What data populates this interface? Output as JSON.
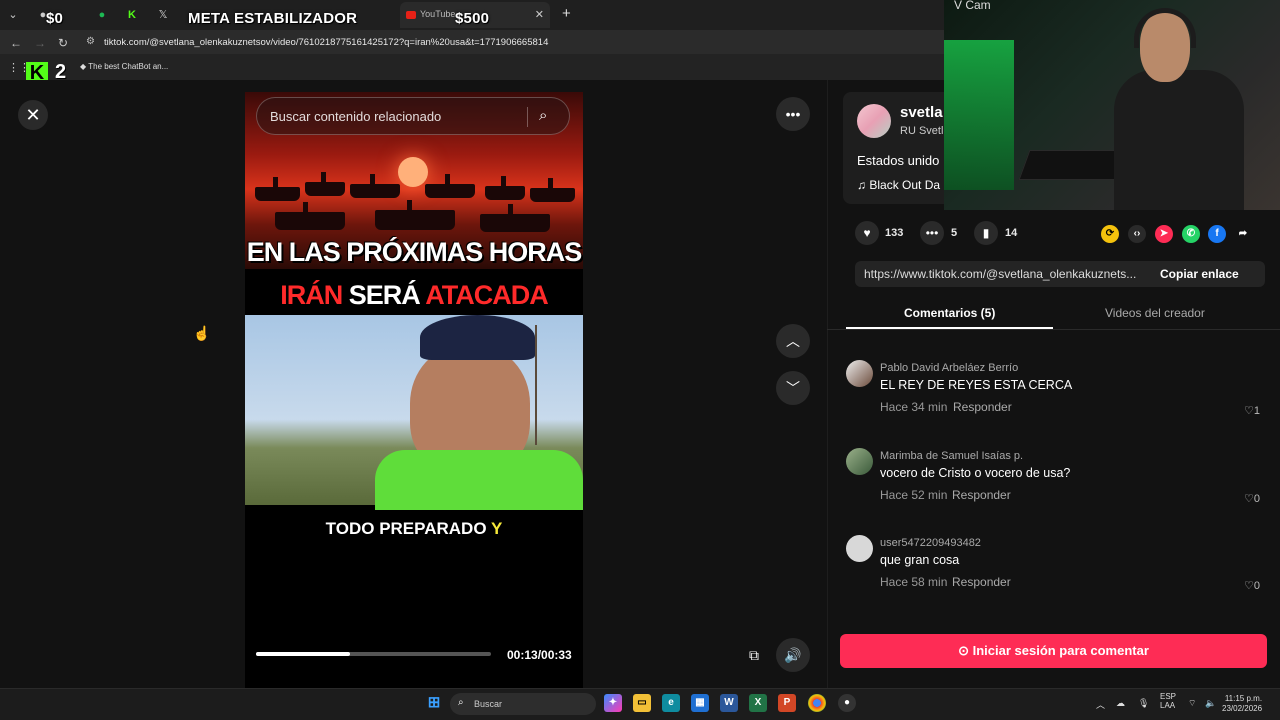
{
  "browser": {
    "overlay_money_left": "$0",
    "overlay_title": "META ESTABILIZADOR",
    "overlay_money_right": "$500",
    "youtube_tab": "YouTube",
    "new_tab": "+",
    "url": "tiktok.com/@svetlana_olenkakuznetsov/video/7610218775161425172?q=iran%20usa&t=1771906665814",
    "bookmark_label": "The best ChatBot an...",
    "kick_number": "2"
  },
  "video": {
    "search_placeholder": "Buscar contenido relacionado",
    "headline_line1": "EN LAS PRÓXIMAS HORAS",
    "headline_line2_a": "IRÁN",
    "headline_line2_b": "SERÁ",
    "headline_line2_c": "ATACADA",
    "caption_main": "TODO PREPARADO",
    "caption_highlight": "Y",
    "time": "00:13/00:33",
    "progress": 0.4
  },
  "author": {
    "name": "svetla",
    "sub": "RU Svetl",
    "description": "Estados unido",
    "music": "Black Out Da"
  },
  "webcam": {
    "label": "V Cam"
  },
  "actions": {
    "likes": "133",
    "comments": "5",
    "saves": "14"
  },
  "link": {
    "url": "https://www.tiktok.com/@svetlana_olenkakuznets...",
    "copy_label": "Copiar enlace"
  },
  "tabs": {
    "comments": "Comentarios (5)",
    "creator_videos": "Videos del creador"
  },
  "comments": [
    {
      "user": "Pablo David Arbeláez Berrío",
      "text": "EL REY DE REYES ESTA CERCA",
      "time": "Hace 34 min",
      "reply": "Responder",
      "likes": "1"
    },
    {
      "user": "Marimba de Samuel Isaías p.",
      "text": "vocero de Cristo o vocero de usa?",
      "time": "Hace 52 min",
      "reply": "Responder",
      "likes": "0"
    },
    {
      "user": "user5472209493482",
      "text": "que gran cosa",
      "time": "Hace 58 min",
      "reply": "Responder",
      "likes": "0"
    }
  ],
  "login_button": "Iniciar sesión para comentar",
  "taskbar": {
    "search": "Buscar",
    "lang_top": "ESP",
    "lang_bottom": "LAA",
    "time": "11:15 p.m.",
    "date": "23/02/2026"
  },
  "colors": {
    "tiktok_red": "#fe2c55",
    "kick_green": "#53fc18"
  }
}
